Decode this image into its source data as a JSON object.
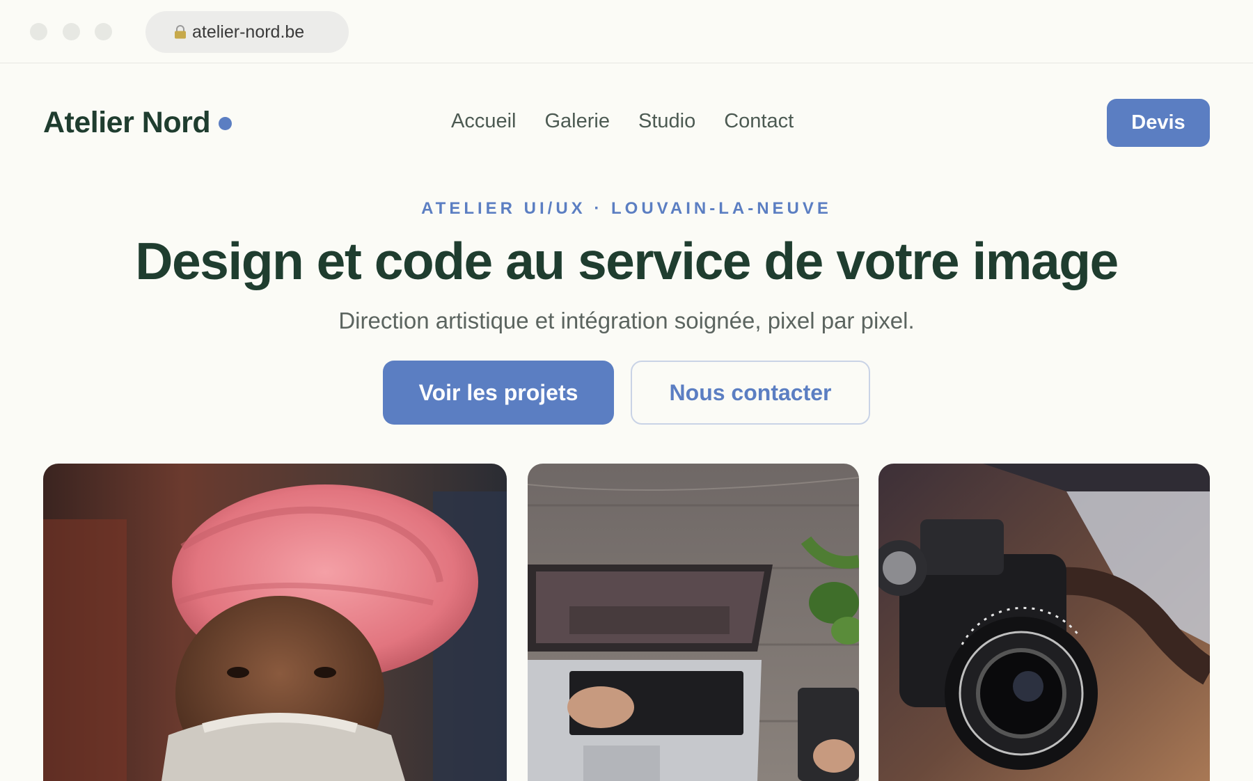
{
  "browser": {
    "url": "atelier-nord.be",
    "lock_icon": "lock-icon"
  },
  "header": {
    "logo_text": "Atelier Nord",
    "nav": [
      {
        "label": "Accueil"
      },
      {
        "label": "Galerie"
      },
      {
        "label": "Studio"
      },
      {
        "label": "Contact"
      }
    ],
    "cta_label": "Devis"
  },
  "hero": {
    "eyebrow": "ATELIER UI/UX · LOUVAIN-LA-NEUVE",
    "title": "Design et code au service de votre image",
    "subtitle": "Direction artistique et intégration soignée, pixel par pixel.",
    "primary_button": "Voir les projets",
    "secondary_button": "Nous contacter"
  },
  "gallery": [
    {
      "subject": "portrait-man-pink-turban"
    },
    {
      "subject": "laptop-on-wooden-desk"
    },
    {
      "subject": "vintage-camera-lens"
    }
  ],
  "colors": {
    "accent": "#5b7ec2",
    "heading": "#1f3d2f",
    "background": "#fbfbf6"
  }
}
